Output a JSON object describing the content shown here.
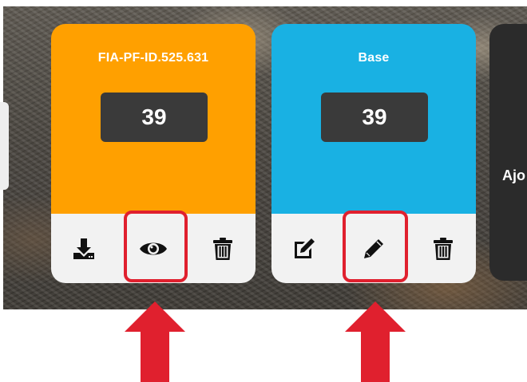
{
  "cards": [
    {
      "title": "FIA-PF-ID.525.631",
      "count": "39",
      "color": "#ffa000",
      "actions": [
        "download-icon",
        "eye-icon",
        "trash-icon"
      ]
    },
    {
      "title": "Base",
      "count": "39",
      "color": "#19b1e3",
      "actions": [
        "edit-icon",
        "pencil-icon",
        "trash-icon"
      ]
    },
    {
      "title": "Ajo",
      "color": "#2b2b2b"
    }
  ],
  "annotation": {
    "highlight_color": "#e0202e",
    "highlighted_actions": [
      "eye-icon",
      "pencil-icon"
    ]
  }
}
